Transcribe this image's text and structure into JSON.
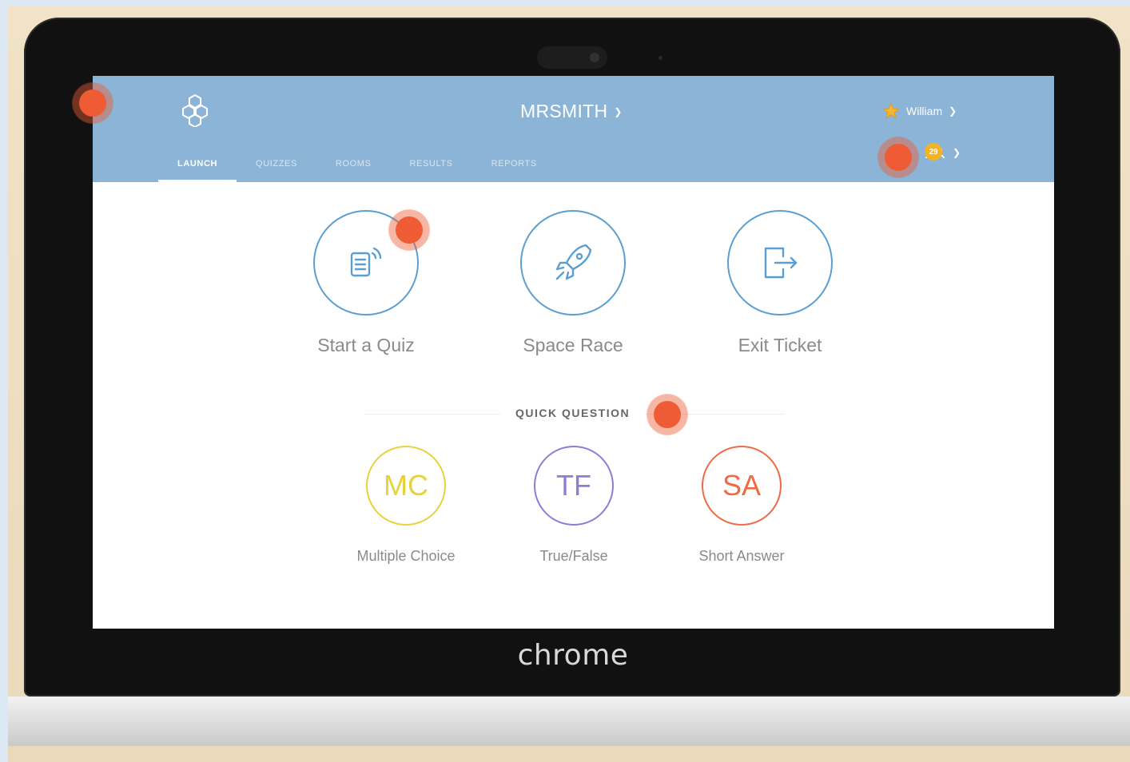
{
  "header": {
    "room_name": "MRSMITH",
    "user_name": "William",
    "student_count": "29",
    "tabs": [
      {
        "label": "LAUNCH",
        "active": true
      },
      {
        "label": "QUIZZES"
      },
      {
        "label": "ROOMS"
      },
      {
        "label": "RESULTS"
      },
      {
        "label": "REPORTS"
      }
    ]
  },
  "launch": {
    "actions": [
      {
        "label": "Start a Quiz",
        "icon": "quiz-document-icon"
      },
      {
        "label": "Space Race",
        "icon": "rocket-icon"
      },
      {
        "label": "Exit Ticket",
        "icon": "exit-door-icon"
      }
    ]
  },
  "quick_question": {
    "title": "QUICK QUESTION",
    "items": [
      {
        "abbr": "MC",
        "label": "Multiple Choice",
        "color": "#e8d23a"
      },
      {
        "abbr": "TF",
        "label": "True/False",
        "color": "#8a7fd6"
      },
      {
        "abbr": "SA",
        "label": "Short Answer",
        "color": "#ef6a45"
      }
    ]
  },
  "device": {
    "brand": "chrome"
  },
  "colors": {
    "header_bg": "#8bb4d6",
    "accent_blue": "#5b9fd2",
    "hotspot": "#ef5b35"
  }
}
